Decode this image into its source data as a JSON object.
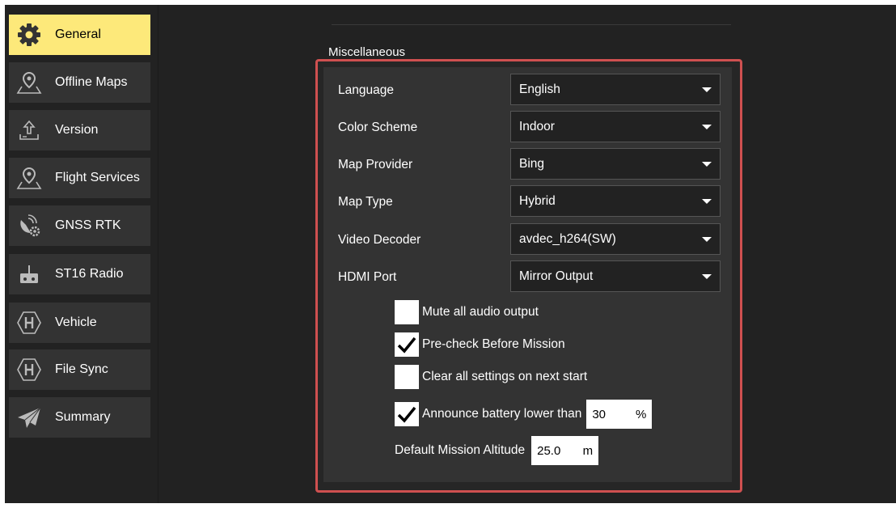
{
  "sidebar": {
    "items": [
      {
        "label": "General",
        "icon": "gear-icon",
        "active": true
      },
      {
        "label": "Offline Maps",
        "icon": "map-pin-icon",
        "active": false
      },
      {
        "label": "Version",
        "icon": "upload-icon",
        "active": false
      },
      {
        "label": "Flight Services",
        "icon": "map-pin-icon",
        "active": false
      },
      {
        "label": "GNSS RTK",
        "icon": "satellite-gear-icon",
        "active": false
      },
      {
        "label": "ST16 Radio",
        "icon": "remote-controller-icon",
        "active": false
      },
      {
        "label": "Vehicle",
        "icon": "hexagon-h-icon",
        "active": false
      },
      {
        "label": "File Sync",
        "icon": "hexagon-h-icon",
        "active": false
      },
      {
        "label": "Summary",
        "icon": "paper-plane-icon",
        "active": false
      }
    ]
  },
  "main": {
    "section_title": "Miscellaneous",
    "settings": [
      {
        "label": "Language",
        "value": "English"
      },
      {
        "label": "Color Scheme",
        "value": "Indoor"
      },
      {
        "label": "Map Provider",
        "value": "Bing"
      },
      {
        "label": "Map Type",
        "value": "Hybrid"
      },
      {
        "label": "Video Decoder",
        "value": "avdec_h264(SW)"
      },
      {
        "label": "HDMI Port",
        "value": "Mirror Output"
      }
    ],
    "checkboxes": [
      {
        "label": "Mute all audio output",
        "checked": false
      },
      {
        "label": "Pre-check Before Mission",
        "checked": true
      },
      {
        "label": "Clear all settings on next start",
        "checked": false
      },
      {
        "label": "Announce battery lower than",
        "checked": true
      }
    ],
    "battery_threshold": {
      "value": "30",
      "unit": "%"
    },
    "default_altitude": {
      "label": "Default Mission Altitude",
      "value": "25.0",
      "unit": "m"
    }
  },
  "colors": {
    "active_nav": "#fde97a",
    "highlight_border": "#cf5050",
    "background": "#222222",
    "panel": "#333333"
  }
}
